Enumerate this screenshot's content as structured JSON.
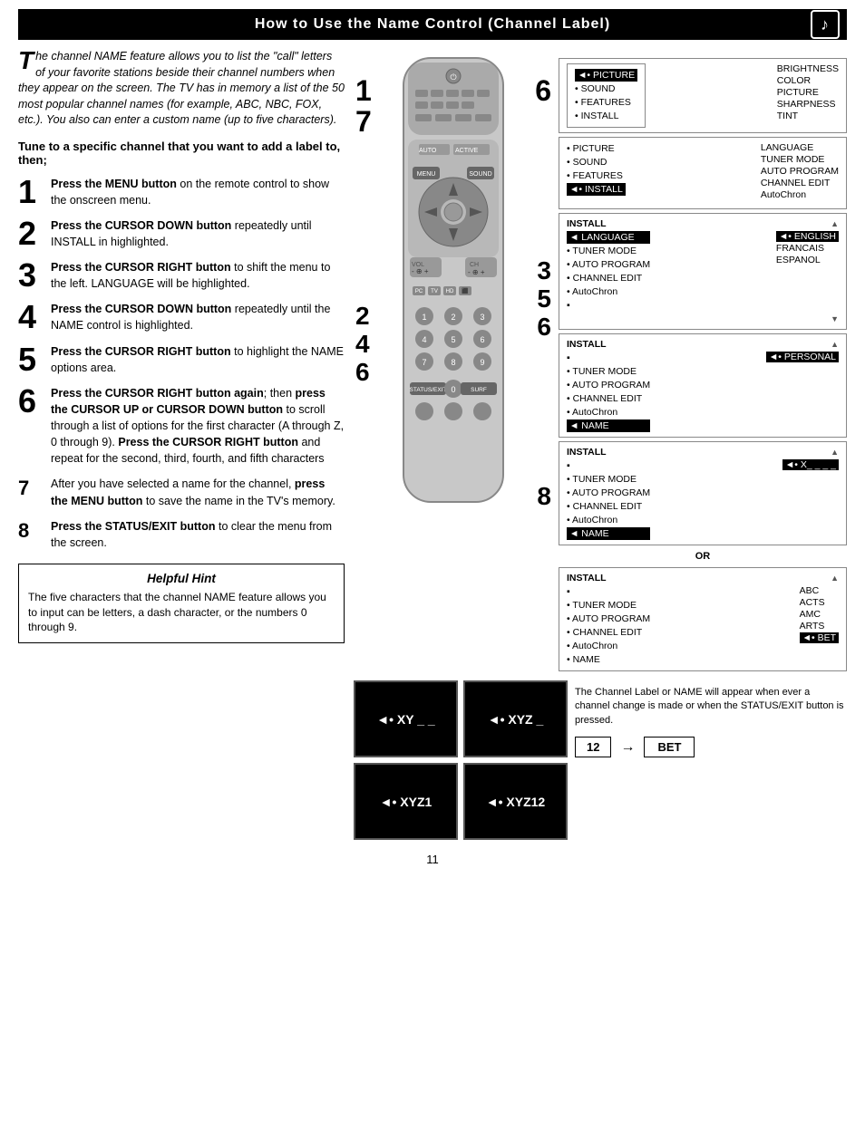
{
  "header": {
    "title": "How to Use the Name Control (Channel Label)",
    "icon": "🎵"
  },
  "intro": {
    "drop_cap": "T",
    "text": "he channel NAME feature allows you to list the \"call\" letters of your favorite stations beside their channel numbers when they appear on the screen.  The TV has in memory a list of the 50 most popular channel names (for example, ABC, NBC, FOX, etc.).  You also can enter a custom name (up to five characters)."
  },
  "tune_label": "Tune to a specific channel that you want to add a label to, then;",
  "steps": [
    {
      "num": "1",
      "text_bold": "Press the MENU button",
      "text_rest": " on the remote control to show the onscreen menu."
    },
    {
      "num": "2",
      "text_bold": "Press the CURSOR DOWN button",
      "text_rest": " repeatedly until INSTALL in highlighted."
    },
    {
      "num": "3",
      "text_bold": "Press the CURSOR RIGHT button",
      "text_rest": " to shift the menu to the left. LANGUAGE will be highlighted."
    },
    {
      "num": "4",
      "text_bold": "Press the CURSOR DOWN button",
      "text_rest": " repeatedly until the NAME control is highlighted."
    },
    {
      "num": "5",
      "text_bold": "Press the CURSOR RIGHT button",
      "text_rest": " to highlight the NAME options area."
    },
    {
      "num": "6",
      "text_bold": "Press the CURSOR RIGHT button again",
      "text_rest": "; then press the CURSOR UP or CURSOR DOWN button to scroll through a list of options for the first character (A through Z, 0 through 9).  Press the CURSOR RIGHT button and repeat for the second, third, fourth, and fifth characters"
    },
    {
      "num": "7",
      "text_rest": "After you have selected a name for the channel, ",
      "text_bold2": "press the MENU button",
      "text_rest2": " to save the name in the TV's memory."
    },
    {
      "num": "8",
      "text_bold": "Press the STATUS/EXIT button",
      "text_rest": " to clear the menu from the screen."
    }
  ],
  "hint": {
    "title": "Helpful Hint",
    "body": "The five characters that the channel NAME feature allows you to input can be letters, a dash character, or the numbers 0 through 9."
  },
  "menus": {
    "panel1": {
      "items_left": [
        "◄• PICTURE",
        "• SOUND",
        "• FEATURES",
        "• INSTALL"
      ],
      "items_right": [
        "BRIGHTNESS",
        "COLOR",
        "PICTURE",
        "SHARPNESS",
        "TINT"
      ]
    },
    "panel2": {
      "title": "",
      "items_left": [
        "• PICTURE",
        "• SOUND",
        "• FEATURES",
        "◄• INSTALL"
      ],
      "items_right": [
        "LANGUAGE",
        "TUNER MODE",
        "AUTO PROGRAM",
        "CHANNEL EDIT",
        "AutoChron"
      ]
    },
    "panel3": {
      "title": "INSTALL",
      "items": [
        "◄ LANGUAGE",
        "• TUNER MODE",
        "• AUTO PROGRAM",
        "• CHANNEL EDIT",
        "• AutoChron",
        "▪"
      ],
      "highlighted": "◄ LANGUAGE",
      "right_items": [
        "◄• ENGLISH",
        "FRANCAIS",
        "ESPANOL"
      ],
      "up_arrow": true,
      "down_arrow": true
    },
    "panel4": {
      "title": "INSTALL",
      "items": [
        "▪",
        "• TUNER MODE",
        "• AUTO PROGRAM",
        "• CHANNEL EDIT",
        "• AutoChron",
        "◄ NAME"
      ],
      "highlighted": "◄ NAME",
      "right_items": [
        "◄• PERSONAL"
      ],
      "up_arrow": true
    },
    "panel5": {
      "title": "INSTALL",
      "items": [
        "▪",
        "• TUNER MODE",
        "• AUTO PROGRAM",
        "• CHANNEL EDIT",
        "• AutoChron",
        "◄ NAME"
      ],
      "highlighted": "◄ NAME",
      "right_val": "◄• X_ _ _ _",
      "up_arrow": true
    },
    "panel6": {
      "title": "INSTALL",
      "items": [
        "▪",
        "• TUNER MODE",
        "• AUTO PROGRAM",
        "• CHANNEL EDIT",
        "• AutoChron",
        "• NAME"
      ],
      "right_items": [
        "ABC",
        "ACTS",
        "AMC",
        "ARTS",
        "◄• BET"
      ],
      "up_arrow": true
    }
  },
  "screens": {
    "screen1": "◄• XY _ _",
    "screen2": "◄• XYZ _",
    "screen3": "◄• XYZ1",
    "screen4": "◄• XYZ12"
  },
  "channel_display": {
    "number": "12",
    "name": "BET"
  },
  "channel_note": "The Channel Label or NAME will appear when ever a channel change is made or when the STATUS/EXIT button is pressed.",
  "page_number": "11",
  "diagram_steps": {
    "left": [
      "1",
      "7"
    ],
    "right_top": [
      "6"
    ],
    "right_bottom": [
      "3",
      "5",
      "6"
    ],
    "bottom_left": [
      "2",
      "4",
      "6"
    ],
    "bottom_right": [
      "8"
    ]
  }
}
